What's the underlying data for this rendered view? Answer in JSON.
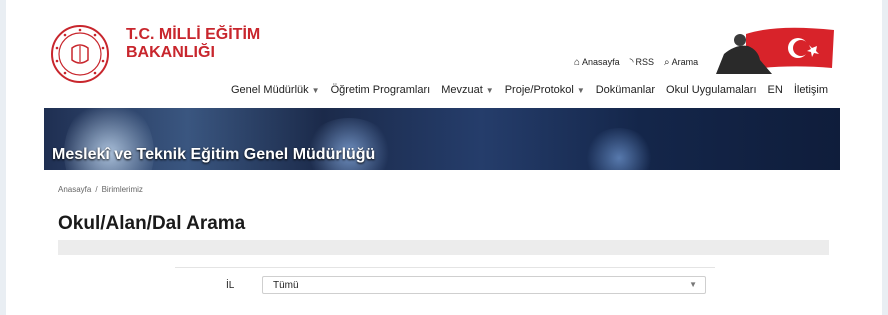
{
  "header": {
    "brand_line1": "T.C. MİLLİ EĞİTİM",
    "brand_line2": "BAKANLIĞI",
    "utility": {
      "home": "Anasayfa",
      "rss": "RSS",
      "search": "Arama"
    },
    "nav": [
      {
        "label": "Genel Müdürlük",
        "dropdown": true
      },
      {
        "label": "Öğretim Programları",
        "dropdown": false
      },
      {
        "label": "Mevzuat",
        "dropdown": true
      },
      {
        "label": "Proje/Protokol",
        "dropdown": true
      },
      {
        "label": "Dokümanlar",
        "dropdown": false
      },
      {
        "label": "Okul Uygulamaları",
        "dropdown": false
      },
      {
        "label": "EN",
        "dropdown": false
      },
      {
        "label": "İletişim",
        "dropdown": false
      }
    ]
  },
  "banner": {
    "title": "Meslekî ve Teknik Eğitim Genel Müdürlüğü"
  },
  "breadcrumb": {
    "home": "Anasayfa",
    "separator": "/",
    "current": "Birimlerimiz"
  },
  "page": {
    "title": "Okul/Alan/Dal Arama"
  },
  "form": {
    "il_label": "İL",
    "il_value": "Tümü"
  },
  "colors": {
    "brand_red": "#c8262d"
  }
}
